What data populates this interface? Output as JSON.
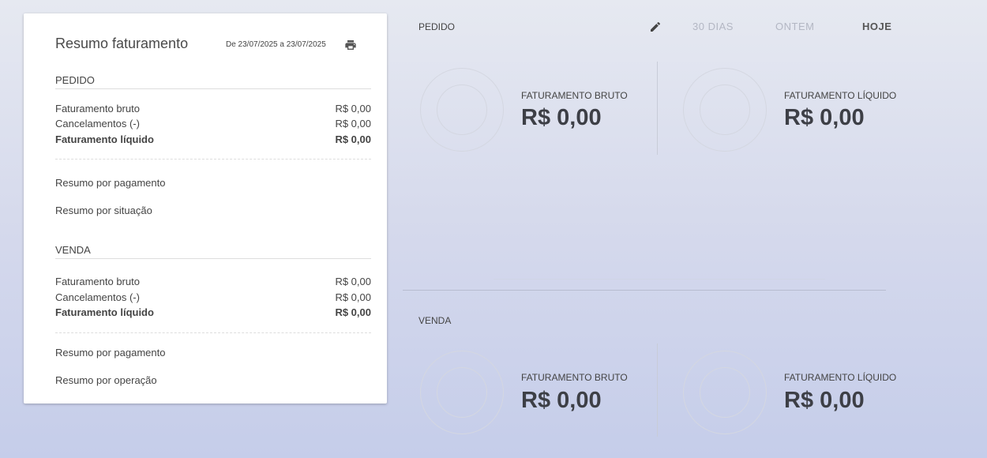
{
  "summary": {
    "title": "Resumo faturamento",
    "date_range": "De 23/07/2025 a 23/07/2025",
    "pedido": {
      "heading": "PEDIDO",
      "rows": [
        {
          "label": "Faturamento bruto",
          "value": "R$ 0,00"
        },
        {
          "label": "Cancelamentos (-)",
          "value": "R$ 0,00"
        },
        {
          "label": "Faturamento líquido",
          "value": "R$ 0,00"
        }
      ],
      "links": [
        "Resumo por pagamento",
        "Resumo por situação"
      ]
    },
    "venda": {
      "heading": "VENDA",
      "rows": [
        {
          "label": "Faturamento bruto",
          "value": "R$ 0,00"
        },
        {
          "label": "Cancelamentos (-)",
          "value": "R$ 0,00"
        },
        {
          "label": "Faturamento líquido",
          "value": "R$ 0,00"
        }
      ],
      "links": [
        "Resumo por pagamento",
        "Resumo por operação"
      ]
    }
  },
  "icons": {
    "print": "print-icon",
    "edit": "pencil-icon"
  },
  "dashboard": {
    "filters": {
      "days30": "30 DIAS",
      "yesterday": "ONTEM",
      "today": "HOJE"
    },
    "pedido": {
      "label": "PEDIDO",
      "bruto_label": "FATURAMENTO BRUTO",
      "bruto_value": "R$ 0,00",
      "liquido_label": "FATURAMENTO LÍQUIDO",
      "liquido_value": "R$ 0,00"
    },
    "venda": {
      "label": "VENDA",
      "bruto_label": "FATURAMENTO BRUTO",
      "bruto_value": "R$ 0,00",
      "liquido_label": "FATURAMENTO LÍQUIDO",
      "liquido_value": "R$ 0,00"
    }
  }
}
